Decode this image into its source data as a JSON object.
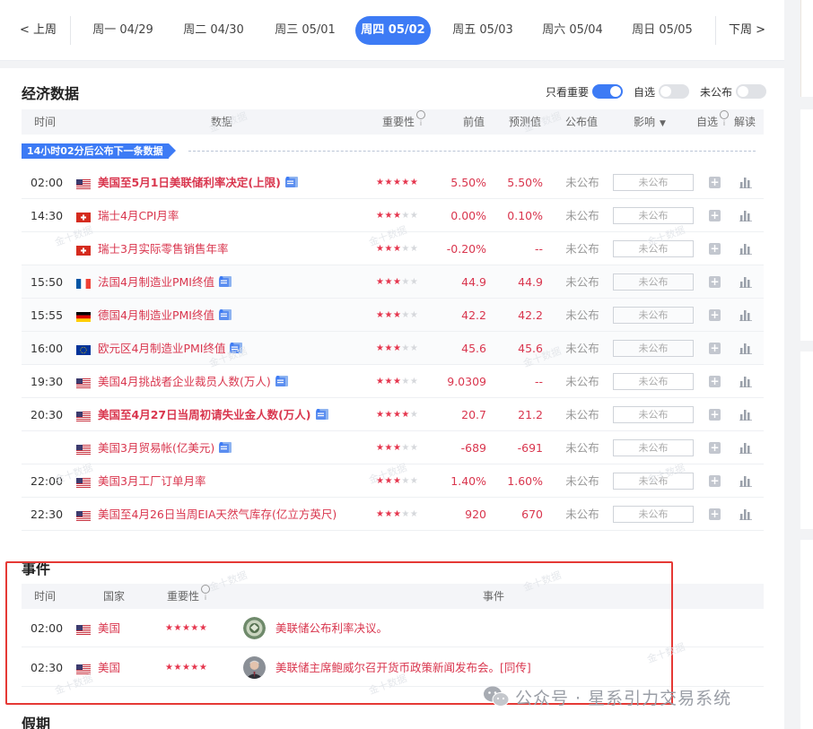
{
  "datebar": {
    "prev_label": "< 上周",
    "next_label": "下周 >",
    "days": [
      {
        "label": "周一 04/29",
        "active": false
      },
      {
        "label": "周二 04/30",
        "active": false
      },
      {
        "label": "周三 05/01",
        "active": false
      },
      {
        "label": "周四 05/02",
        "active": true
      },
      {
        "label": "周五 05/03",
        "active": false
      },
      {
        "label": "周六 05/04",
        "active": false
      },
      {
        "label": "周日 05/05",
        "active": false
      }
    ]
  },
  "econ": {
    "title": "经济数据",
    "toggles": [
      {
        "label": "只看重要",
        "on": true
      },
      {
        "label": "自选",
        "on": false
      },
      {
        "label": "未公布",
        "on": false
      }
    ],
    "headers": {
      "time": "时间",
      "data": "数据",
      "importance": "重要性",
      "prev": "前值",
      "forecast": "预测值",
      "published": "公布值",
      "impact": "影响",
      "watch": "自选",
      "analysis": "解读"
    },
    "countdown": "14小时02分后公布下一条数据",
    "rows": [
      {
        "time": "02:00",
        "flag": "us",
        "name": "美国至5月1日美联储利率决定(上限)",
        "bold": true,
        "doc": true,
        "stars": 5,
        "prev": "5.50%",
        "forecast": "5.50%",
        "published": "未公布",
        "impact": "未公布"
      },
      {
        "time": "14:30",
        "flag": "ch",
        "name": "瑞士4月CPI月率",
        "bold": false,
        "doc": false,
        "stars": 3,
        "prev": "0.00%",
        "forecast": "0.10%",
        "published": "未公布",
        "impact": "未公布"
      },
      {
        "time": "",
        "flag": "ch",
        "name": "瑞士3月实际零售销售年率",
        "bold": false,
        "doc": false,
        "stars": 3,
        "prev": "-0.20%",
        "forecast": "--",
        "published": "未公布",
        "impact": "未公布"
      },
      {
        "time": "15:50",
        "flag": "fr",
        "name": "法国4月制造业PMI终值",
        "bold": false,
        "doc": true,
        "stars": 3,
        "prev": "44.9",
        "forecast": "44.9",
        "published": "未公布",
        "impact": "未公布"
      },
      {
        "time": "15:55",
        "flag": "de",
        "name": "德国4月制造业PMI终值",
        "bold": false,
        "doc": true,
        "stars": 3,
        "prev": "42.2",
        "forecast": "42.2",
        "published": "未公布",
        "impact": "未公布"
      },
      {
        "time": "16:00",
        "flag": "eu",
        "name": "欧元区4月制造业PMI终值",
        "bold": false,
        "doc": true,
        "stars": 3,
        "prev": "45.6",
        "forecast": "45.6",
        "published": "未公布",
        "impact": "未公布"
      },
      {
        "time": "19:30",
        "flag": "us",
        "name": "美国4月挑战者企业裁员人数(万人)",
        "bold": false,
        "doc": true,
        "stars": 3,
        "prev": "9.0309",
        "forecast": "--",
        "published": "未公布",
        "impact": "未公布"
      },
      {
        "time": "20:30",
        "flag": "us",
        "name": "美国至4月27日当周初请失业金人数(万人)",
        "bold": true,
        "doc": true,
        "stars": 4,
        "prev": "20.7",
        "forecast": "21.2",
        "published": "未公布",
        "impact": "未公布"
      },
      {
        "time": "",
        "flag": "us",
        "name": "美国3月贸易帐(亿美元)",
        "bold": false,
        "doc": true,
        "stars": 3,
        "prev": "-689",
        "forecast": "-691",
        "published": "未公布",
        "impact": "未公布"
      },
      {
        "time": "22:00",
        "flag": "us",
        "name": "美国3月工厂订单月率",
        "bold": false,
        "doc": false,
        "stars": 3,
        "prev": "1.40%",
        "forecast": "1.60%",
        "published": "未公布",
        "impact": "未公布"
      },
      {
        "time": "22:30",
        "flag": "us",
        "name": "美国至4月26日当周EIA天然气库存(亿立方英尺)",
        "bold": false,
        "doc": false,
        "stars": 3,
        "prev": "920",
        "forecast": "670",
        "published": "未公布",
        "impact": "未公布"
      }
    ]
  },
  "events": {
    "title": "事件",
    "headers": {
      "time": "时间",
      "country": "国家",
      "importance": "重要性",
      "event": "事件"
    },
    "rows": [
      {
        "time": "02:00",
        "flag": "us",
        "country": "美国",
        "stars": 5,
        "avatar": "fed-seal",
        "text": "美联储公布利率决议。"
      },
      {
        "time": "02:30",
        "flag": "us",
        "country": "美国",
        "stars": 5,
        "avatar": "person",
        "text": "美联储主席鲍威尔召开货币政策新闻发布会。[同传]"
      }
    ]
  },
  "holidays": {
    "title": "假期"
  },
  "watermark": {
    "text": "金十数据"
  },
  "wechat": {
    "text": "公众号 · 星系引力交易系统"
  },
  "colors": {
    "accent": "#3d7bf5",
    "red": "#d9364e",
    "highlight_box": "#e53935"
  }
}
